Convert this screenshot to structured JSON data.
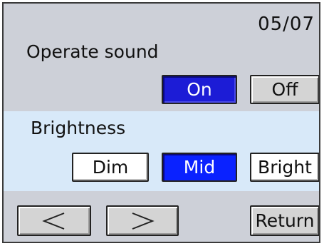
{
  "page_indicator": "05/07",
  "sound": {
    "label": "Operate sound",
    "options": [
      "On",
      "Off"
    ],
    "selected": "On"
  },
  "brightness": {
    "label": "Brightness",
    "options": [
      "Dim",
      "Mid",
      "Bright"
    ],
    "selected": "Mid"
  },
  "nav": {
    "prev_icon": "chevron-left-icon",
    "next_icon": "chevron-right-icon",
    "return_label": "Return"
  },
  "colors": {
    "panel_gray": "#cdd0d8",
    "panel_light_blue": "#d8e9f9",
    "selected_blue": "#1c1cd6",
    "selected_bright_blue": "#0a22ff"
  }
}
